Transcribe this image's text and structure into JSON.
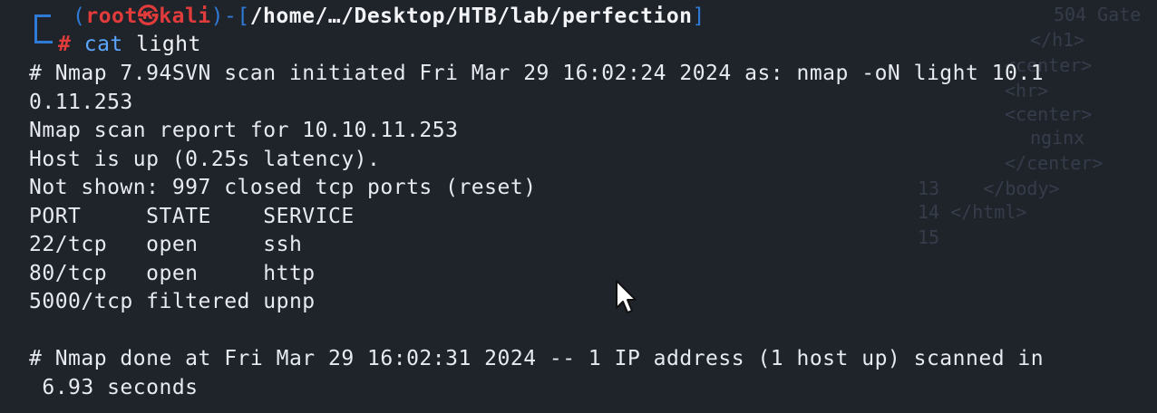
{
  "prompt": {
    "open_paren": "(",
    "user": "root",
    "at_symbol": "㉿",
    "host": "kali",
    "close_paren_dash": ")-",
    "path_open": "[",
    "path": "/home/…/Desktop/HTB/lab/perfection",
    "path_close": "]",
    "hash": "#",
    "command": "cat",
    "argument": "light"
  },
  "output_lines": [
    "# Nmap 7.94SVN scan initiated Fri Mar 29 16:02:24 2024 as: nmap -oN light 10.1",
    "0.11.253",
    "Nmap scan report for 10.10.11.253",
    "Host is up (0.25s latency).",
    "Not shown: 997 closed tcp ports (reset)",
    "PORT     STATE    SERVICE",
    "22/tcp   open     ssh",
    "80/tcp   open     http",
    "5000/tcp filtered upnp",
    "",
    "# Nmap done at Fri Mar 29 16:02:31 2024 -- 1 IP address (1 host up) scanned in",
    " 6.93 seconds"
  ],
  "background_ghost": [
    "504 Gate",
    "</h1>",
    "<center>",
    "<hr>",
    "<center>",
    "nginx",
    "</center>",
    "13    </body>",
    "14 </html>",
    "15"
  ],
  "colors": {
    "background": "#1f232a",
    "prompt_blue": "#2f7bd8",
    "prompt_red": "#e23b3b",
    "text": "#e7ebf0"
  }
}
